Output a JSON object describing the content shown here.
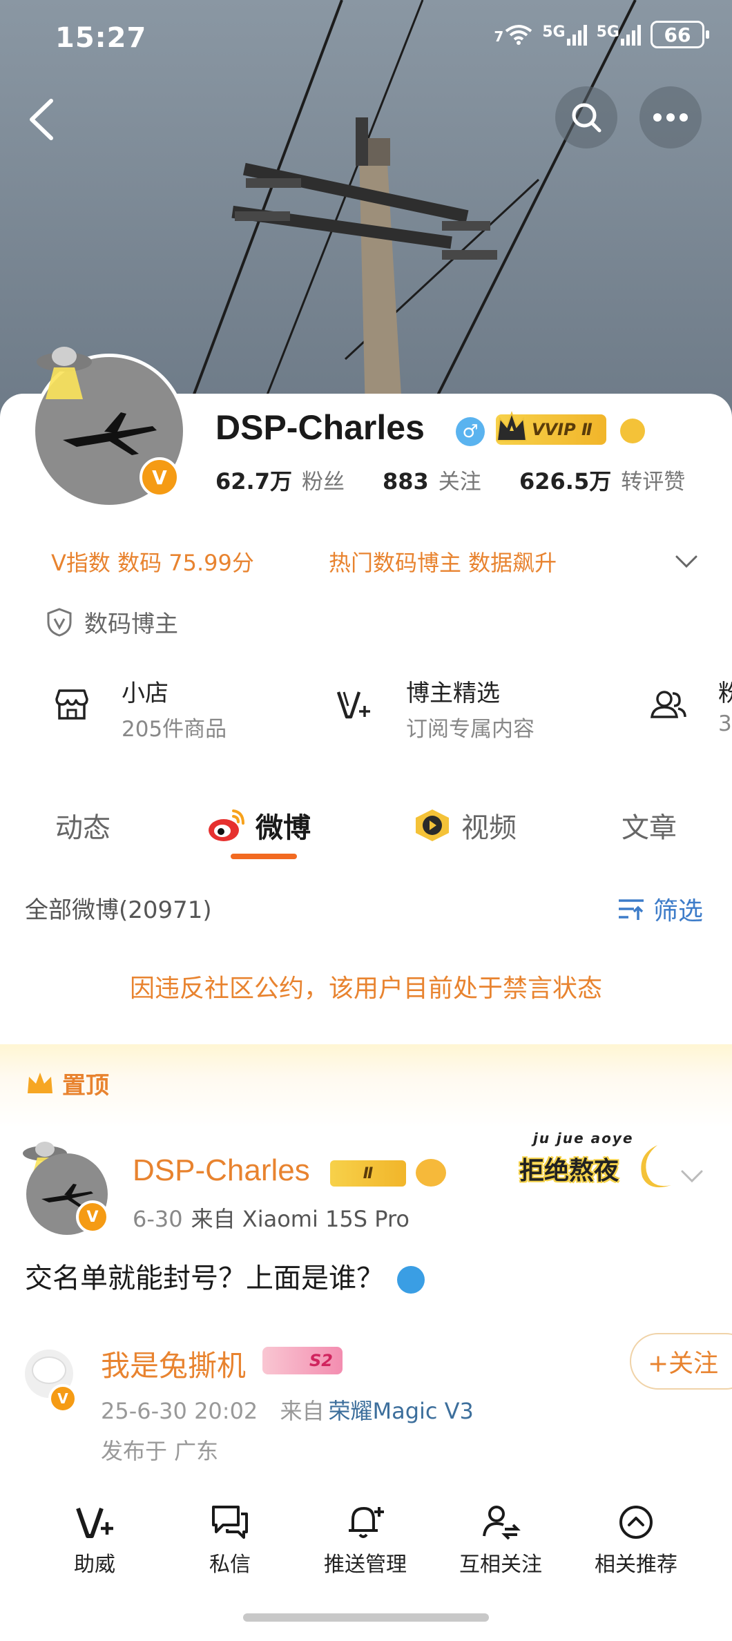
{
  "status_bar": {
    "time": "15:27",
    "wifi_label": "7",
    "net1": "5G",
    "net2": "5G",
    "battery": "66"
  },
  "profile": {
    "name": "DSP-Charles",
    "gender_symbol": "♂",
    "vip_badge": "VVIP Ⅱ",
    "verified_badge": "V",
    "stats": [
      {
        "value": "62.7万",
        "label": "粉丝"
      },
      {
        "value": "883",
        "label": "关注"
      },
      {
        "value": "626.5万",
        "label": "转评赞"
      }
    ],
    "v_index": "V指数 数码 75.99分",
    "hot_tag": "热门数码博主 数据飙升",
    "tagline": "数码博主"
  },
  "services": [
    {
      "title": "小店",
      "subtitle": "205件商品",
      "icon": "store-icon"
    },
    {
      "title": "博主精选",
      "subtitle": "订阅专属内容",
      "icon": "v-plus-icon"
    },
    {
      "title": "粉",
      "subtitle": "3",
      "icon": "fans-group-icon"
    }
  ],
  "tabs": [
    "动态",
    "微博",
    "视频",
    "文章"
  ],
  "active_tab": "微博",
  "feed": {
    "all_posts": "全部微博(20971)",
    "filter": "筛选",
    "notice": "因违反社区公约，该用户目前处于禁言状态",
    "pinned": "置顶",
    "post": {
      "author": "DSP-Charles",
      "badge": "Ⅱ",
      "date": "6-30",
      "source": "来自 Xiaomi 15S Pro",
      "text": "交名单就能封号？上面是谁？",
      "sticker_top": "ju jue aoye",
      "sticker_main": "拒绝熬夜"
    },
    "comment": {
      "author": "我是兔撕机",
      "level": "S2",
      "datetime": "25-6-30 20:02",
      "source_prefix": "来自",
      "source": "荣耀Magic V3",
      "location": "发布于 广东",
      "follow": "+关注"
    }
  },
  "bottom_bar": [
    {
      "label": "助威",
      "icon": "v-plus-icon"
    },
    {
      "label": "私信",
      "icon": "message-icon"
    },
    {
      "label": "推送管理",
      "icon": "bell-plus-icon"
    },
    {
      "label": "互相关注",
      "icon": "mutual-follow-icon"
    },
    {
      "label": "相关推荐",
      "icon": "chevron-up-circle-icon"
    }
  ],
  "colors": {
    "accent": "#e8832f",
    "tab_underline": "#f26a21",
    "link_blue": "#3d7cc9"
  }
}
